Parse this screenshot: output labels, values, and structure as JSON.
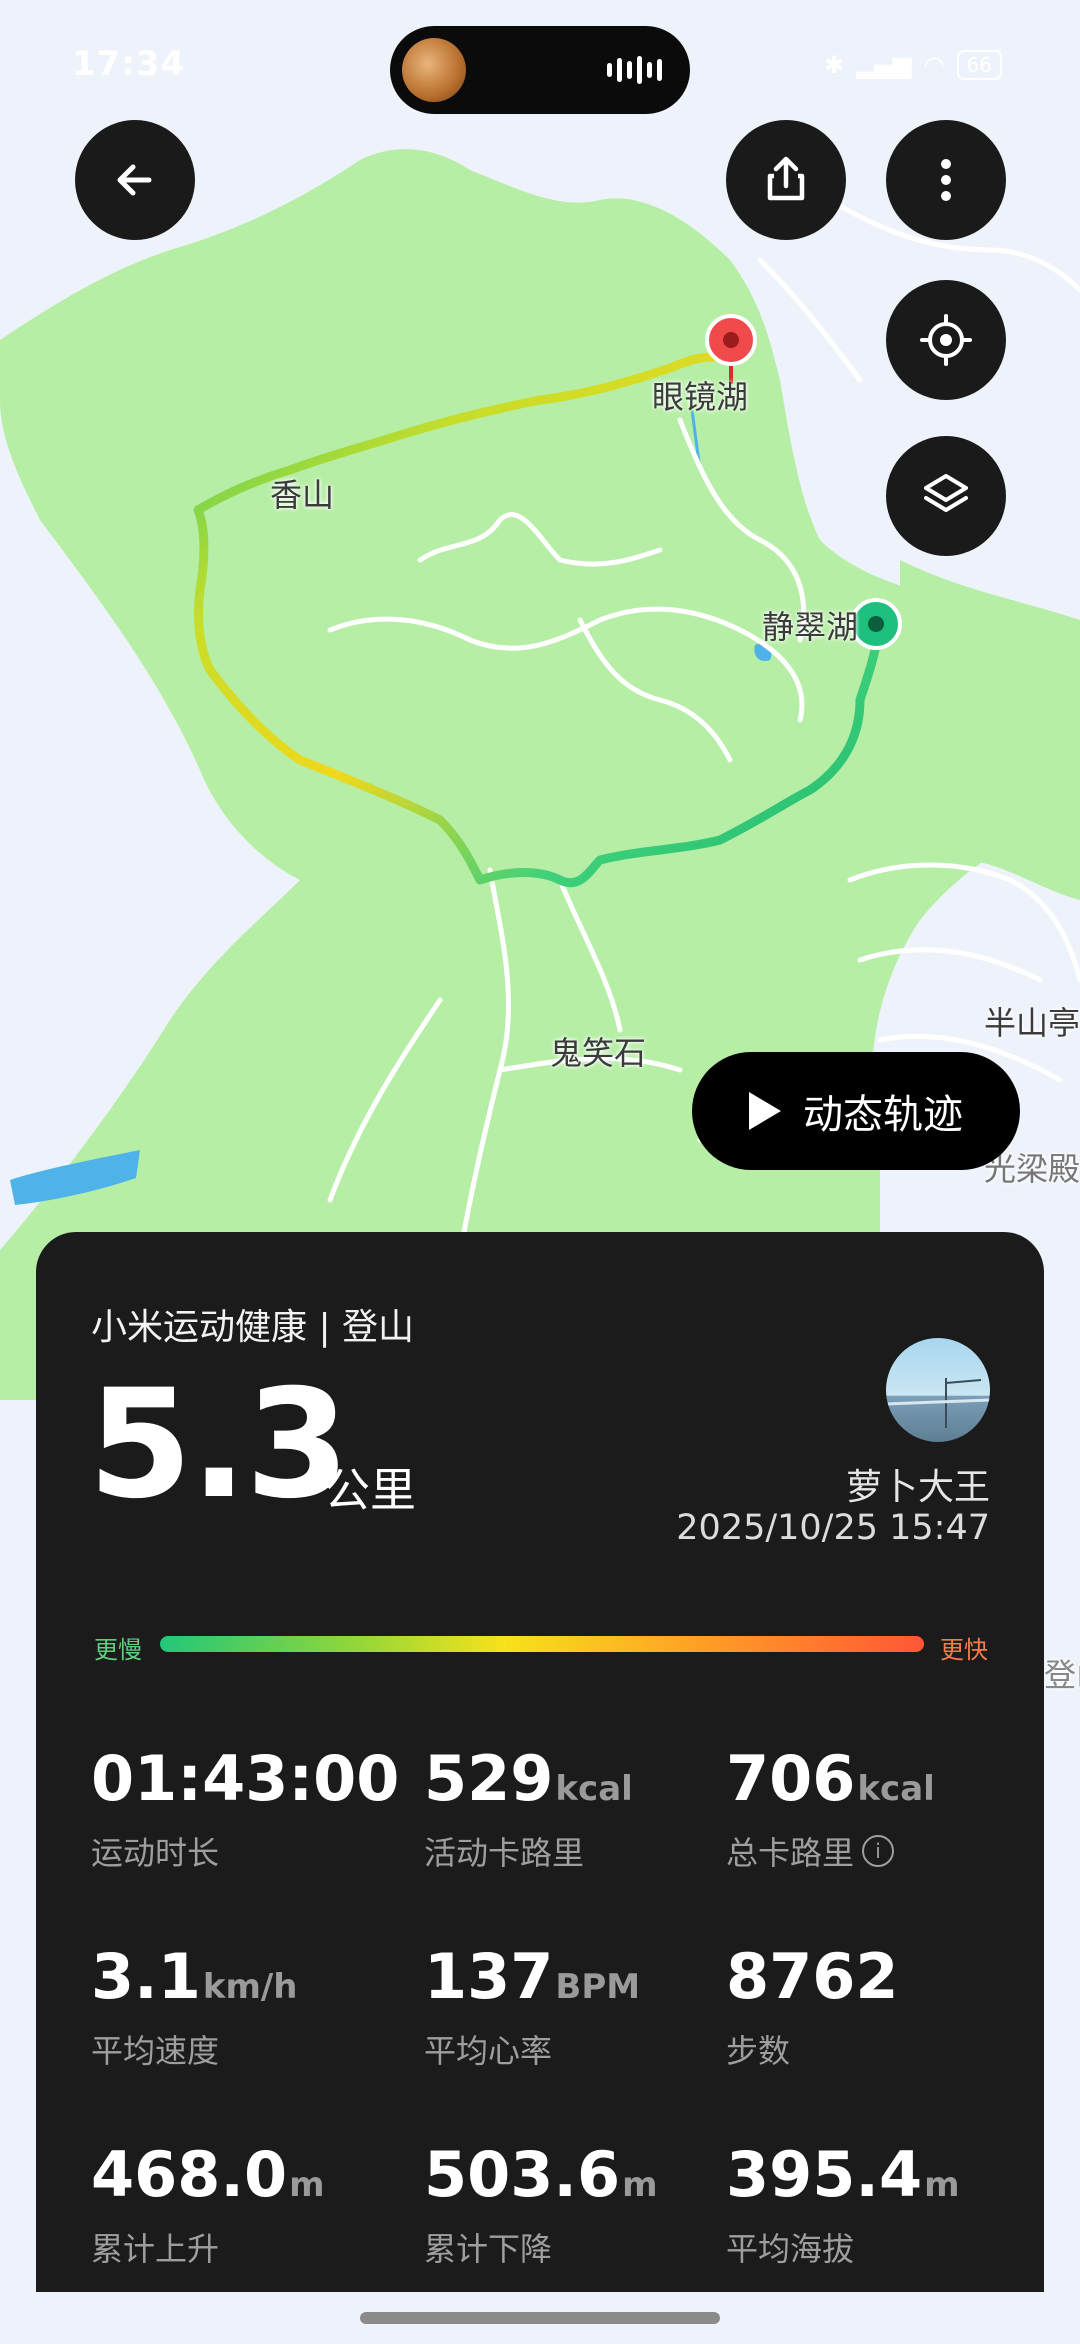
{
  "status_bar": {
    "time": "17:34",
    "battery": "66"
  },
  "map": {
    "labels": {
      "yanjinghu": "眼镜湖",
      "xiangshan": "香山",
      "jingcuihu": "静翠湖",
      "guixiaoshi": "鬼笑石",
      "banshanting": "半山亭",
      "guangliang": "光梁殿",
      "right_edge": "登山"
    },
    "markers": {
      "end": "end-pin",
      "start": "start-pin"
    }
  },
  "top_buttons": {
    "back": "arrow-left-icon",
    "share": "share-icon",
    "more": "more-vertical-icon",
    "locate": "locate-icon",
    "layers": "layers-icon"
  },
  "replay": {
    "label": "动态轨迹"
  },
  "summary": {
    "brand": "小米运动健康 | 登山",
    "distance_value": "5.3",
    "distance_unit": "公里",
    "user_name": "萝卜大王",
    "datetime": "2025/10/25 15:47",
    "speed_legend": {
      "slow": "更慢",
      "fast": "更快"
    }
  },
  "stats": [
    {
      "value": "01:43:00",
      "unit": "",
      "label": "运动时长"
    },
    {
      "value": "529",
      "unit": "kcal",
      "label": "活动卡路里"
    },
    {
      "value": "706",
      "unit": "kcal",
      "label": "总卡路里"
    },
    {
      "value": "3.1",
      "unit": "km/h",
      "label": "平均速度"
    },
    {
      "value": "137",
      "unit": "BPM",
      "label": "平均心率"
    },
    {
      "value": "8762",
      "unit": "",
      "label": "步数"
    },
    {
      "value": "468.0",
      "unit": "m",
      "label": "累计上升"
    },
    {
      "value": "503.6",
      "unit": "m",
      "label": "累计下降"
    },
    {
      "value": "395.4",
      "unit": "m",
      "label": "平均海拔"
    }
  ],
  "colors": {
    "panel": "#1b1b1b",
    "park": "#b6eea6",
    "route_slow": "#22c77a",
    "route_fast": "#ff5636"
  }
}
